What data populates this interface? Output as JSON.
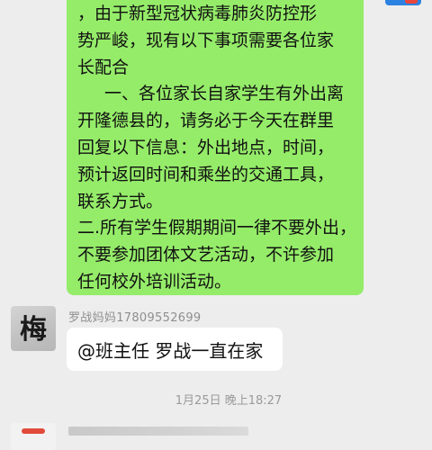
{
  "messages": {
    "outgoing": {
      "lines": [
        "，由于新型冠状病毒肺炎防控形",
        "势严峻，现有以下事项需要各位家",
        "长配合",
        "一、各位家长自家学生有外出离",
        "开隆德县的，请务必于今天在群里",
        "回复以下信息：外出地点，时间，",
        "预计返回时间和乘坐的交通工具，",
        "联系方式。",
        "二.所有学生假期期间一律不要外出，",
        "不要参加团体文艺活动，不许参加",
        "任何校外培训活动。"
      ],
      "bubble_color": "#95ec69"
    },
    "incoming": {
      "sender": "罗战妈妈17809552699",
      "text": "@班主任  罗战一直在家",
      "avatar_glyph": "梅"
    },
    "timestamp": "1月25日 晚上18:27"
  },
  "colors": {
    "background": "#ededed",
    "incoming_bubble": "#ffffff",
    "meta_text": "#9a9a9a"
  }
}
